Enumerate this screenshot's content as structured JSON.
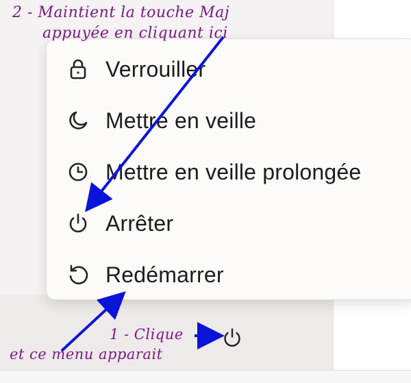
{
  "power_menu": {
    "items": [
      {
        "label": "Verrouiller",
        "icon": "lock-icon"
      },
      {
        "label": "Mettre en veille",
        "icon": "moon-icon"
      },
      {
        "label": "Mettre en veille prolongée",
        "icon": "clock-icon"
      },
      {
        "label": "Arrêter",
        "icon": "power-icon"
      },
      {
        "label": "Redémarrer",
        "icon": "restart-icon"
      }
    ]
  },
  "taskbar": {
    "power_button_icon": "power-icon"
  },
  "annotations": {
    "step2_line1": "2 - Maintient la touche Maj",
    "step2_line2": "appuyée en cliquant ici",
    "step1_line1": "1 - Clique",
    "step1_line2": "et ce menu apparait",
    "color": "#7a1a86",
    "arrow_color": "#0a14d8"
  }
}
